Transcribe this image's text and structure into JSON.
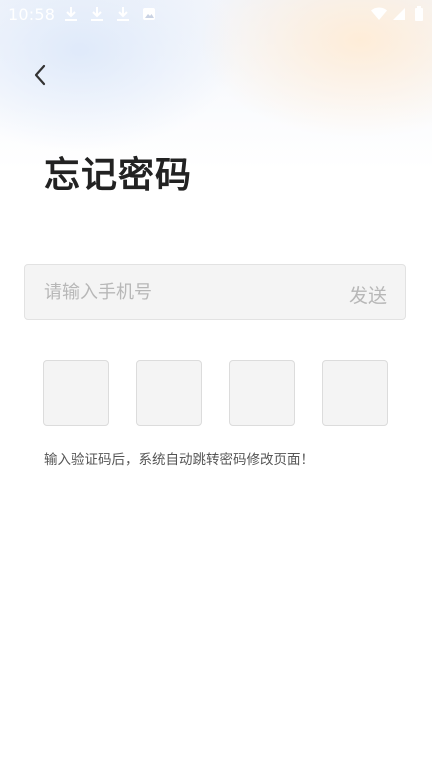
{
  "status_bar": {
    "time": "10:58",
    "left_icons": [
      "download-icon",
      "download-icon",
      "download-icon",
      "image-notification-icon"
    ],
    "right_icons": [
      "wifi-icon",
      "signal-icon",
      "battery-icon"
    ]
  },
  "header": {
    "back_icon": "chevron-left-icon"
  },
  "page": {
    "title": "忘记密码"
  },
  "phone": {
    "placeholder": "请输入手机号",
    "value": "",
    "send_label": "发送"
  },
  "verification": {
    "box_count": 4,
    "values": [
      "",
      "",
      "",
      ""
    ]
  },
  "hint": "输入验证码后，系统自动跳转密码修改页面！",
  "colors": {
    "title": "#222222",
    "placeholder": "#b7b7b7",
    "input_bg": "#f4f4f4",
    "hint": "#555555"
  }
}
